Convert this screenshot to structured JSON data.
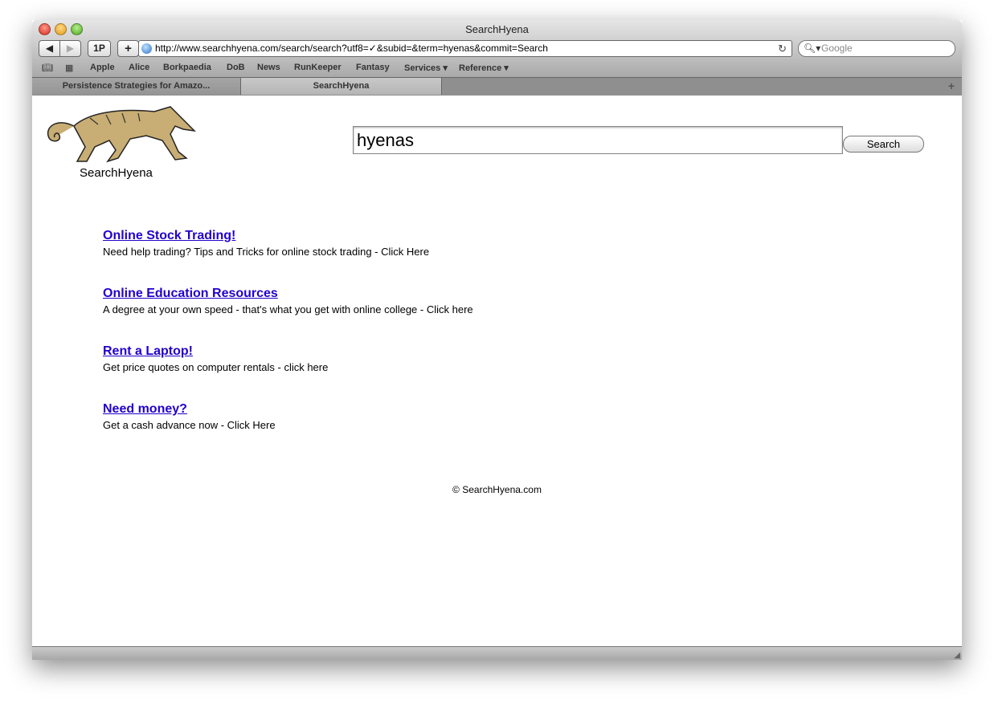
{
  "window": {
    "title": "SearchHyena"
  },
  "toolbar": {
    "back": "◀",
    "forward": "▶",
    "onepassword": "1P",
    "add": "+",
    "url": "http://www.searchhyena.com/search/search?utf8=✓&subid=&term=hyenas&commit=Search",
    "search_placeholder": "Google"
  },
  "bookmarks": [
    "Apple",
    "Alice",
    "Borkpaedia",
    "DoB",
    "News",
    "RunKeeper",
    "Fantasy",
    "Services ▾",
    "Reference ▾"
  ],
  "tabs": [
    {
      "label": "Persistence Strategies for Amazo..."
    },
    {
      "label": "SearchHyena"
    }
  ],
  "page": {
    "logo_text": "SearchHyena",
    "search_value": "hyenas",
    "search_button": "Search",
    "ads": [
      {
        "title": "Online Stock Trading!",
        "desc": "Need help trading? Tips and Tricks for online stock trading - Click Here"
      },
      {
        "title": "Online Education Resources",
        "desc": "A degree at your own speed - that's what you get with online college - Click here"
      },
      {
        "title": "Rent a Laptop!",
        "desc": "Get price quotes on computer rentals - click here"
      },
      {
        "title": "Need money?",
        "desc": "Get a cash advance now - Click Here"
      }
    ],
    "footer": "© SearchHyena.com"
  },
  "colors": {
    "link": "#2200cc",
    "hyena": "#c8ad74"
  }
}
